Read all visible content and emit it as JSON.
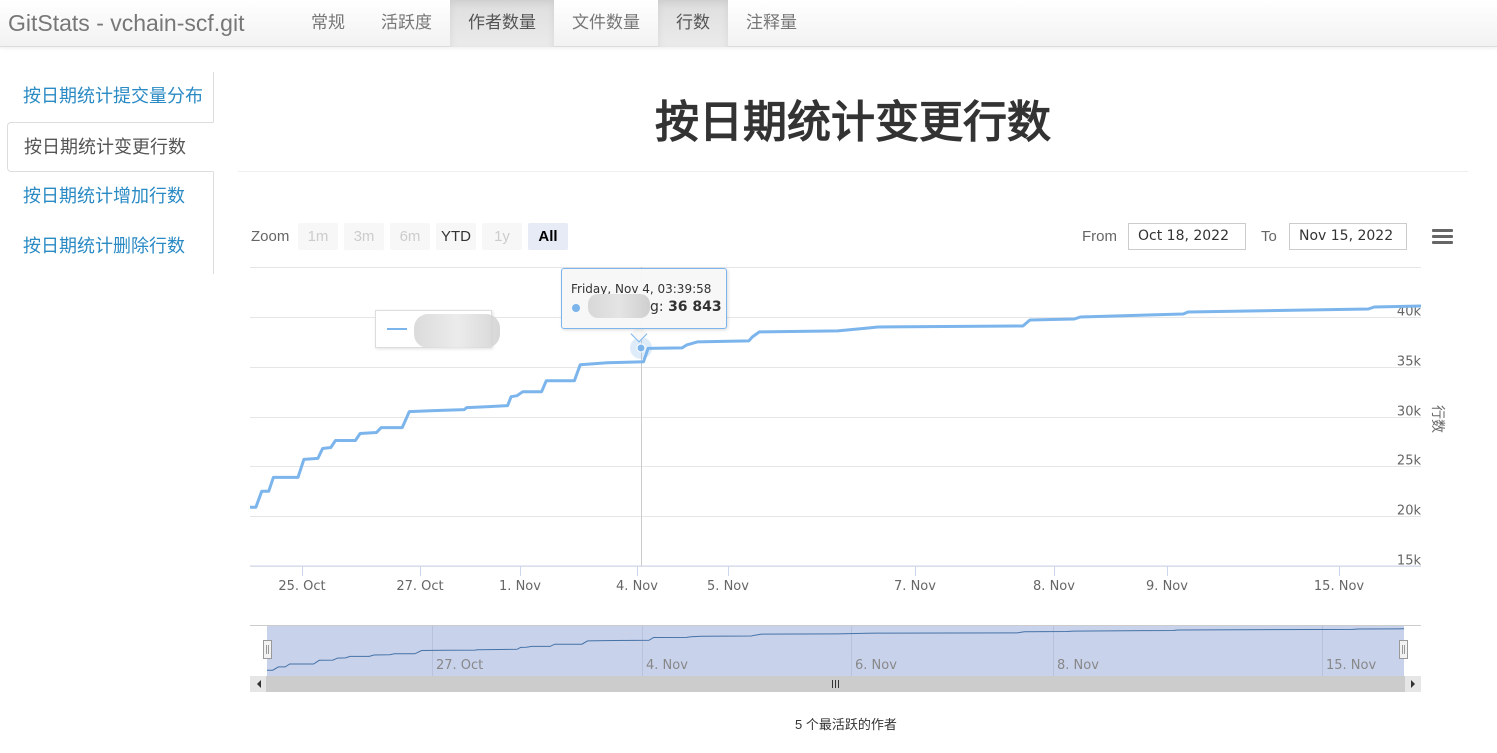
{
  "app": {
    "brand": "GitStats - vchain-scf.git",
    "nav_tabs": [
      {
        "label": "常规",
        "active": false
      },
      {
        "label": "活跃度",
        "active": false
      },
      {
        "label": "作者数量",
        "active": true
      },
      {
        "label": "文件数量",
        "active": false
      },
      {
        "label": "行数",
        "active": true
      },
      {
        "label": "注释量",
        "active": false
      }
    ]
  },
  "sidebar": {
    "items": [
      {
        "label": "按日期统计提交量分布",
        "active": false
      },
      {
        "label": "按日期统计变更行数",
        "active": true
      },
      {
        "label": "按日期统计增加行数",
        "active": false
      },
      {
        "label": "按日期统计删除行数",
        "active": false
      }
    ]
  },
  "page": {
    "title": "按日期统计变更行数",
    "footer_caption": "5 个最活跃的作者"
  },
  "range_selector": {
    "zoom_label": "Zoom",
    "buttons": [
      {
        "label": "1m",
        "state": "disabled"
      },
      {
        "label": "3m",
        "state": "disabled"
      },
      {
        "label": "6m",
        "state": "disabled"
      },
      {
        "label": "YTD",
        "state": "enabled"
      },
      {
        "label": "1y",
        "state": "disabled"
      },
      {
        "label": "All",
        "state": "selected"
      }
    ],
    "from_label": "From",
    "from_value": "Oct 18, 2022",
    "to_label": "To",
    "to_value": "Nov 15, 2022",
    "menu_icon": "hamburger-menu-icon"
  },
  "tooltip": {
    "date": "Friday, Nov 4, 03:39:58",
    "series_suffix": "g: ",
    "value": "36 843"
  },
  "colors": {
    "series": "#7cb5ec",
    "navigator_series": "#4572a7",
    "navigator_mask": "#c8d2eb",
    "link": "#2a8ac4"
  },
  "chart_data": {
    "type": "line",
    "title": "按日期统计变更行数",
    "xlabel": "",
    "ylabel": "行数",
    "ylim": [
      15000,
      40000
    ],
    "y_ticks": [
      "15k",
      "20k",
      "25k",
      "30k",
      "35k",
      "40k"
    ],
    "x_tick_labels": [
      "25. Oct",
      "27. Oct",
      "1. Nov",
      "4. Nov",
      "5. Nov",
      "7. Nov",
      "8. Nov",
      "9. Nov",
      "15. Nov"
    ],
    "navigator_tick_labels": [
      "27. Oct",
      "4. Nov",
      "6. Nov",
      "8. Nov",
      "15. Nov"
    ],
    "grid": true,
    "legend": "top-left",
    "series": [
      {
        "name": "(blurred author)",
        "x": [
          0,
          0.5,
          1,
          1.6,
          2,
          4.1,
          4.6,
          5.8,
          6.2,
          6.9,
          7.3,
          9.0,
          9.4,
          10.8,
          11.2,
          13.0,
          13.6,
          15.7,
          18.3,
          18.5,
          20.4,
          22.0,
          22.3,
          22.8,
          23.3,
          24.9,
          25.3,
          27.7,
          28.2,
          30.5,
          33.6,
          34.0,
          36.9,
          37.3,
          38.2,
          42.6,
          42.9,
          43.5,
          50.2,
          52.8,
          53.6,
          66.0,
          66.6,
          70.4,
          70.9,
          79.7,
          80.1,
          95.5,
          96.0,
          100
        ],
        "values": [
          20900,
          20900,
          22500,
          22500,
          23900,
          23900,
          25700,
          25800,
          26800,
          26900,
          27600,
          27600,
          28300,
          28400,
          28900,
          28900,
          30500,
          30600,
          30700,
          30900,
          31000,
          31100,
          32000,
          32100,
          32500,
          32500,
          33600,
          33600,
          35200,
          35400,
          35500,
          36843,
          36900,
          37200,
          37500,
          37600,
          38000,
          38500,
          38600,
          38900,
          39000,
          39100,
          39700,
          39800,
          40000,
          40300,
          40500,
          40800,
          41000,
          41100
        ]
      }
    ]
  }
}
